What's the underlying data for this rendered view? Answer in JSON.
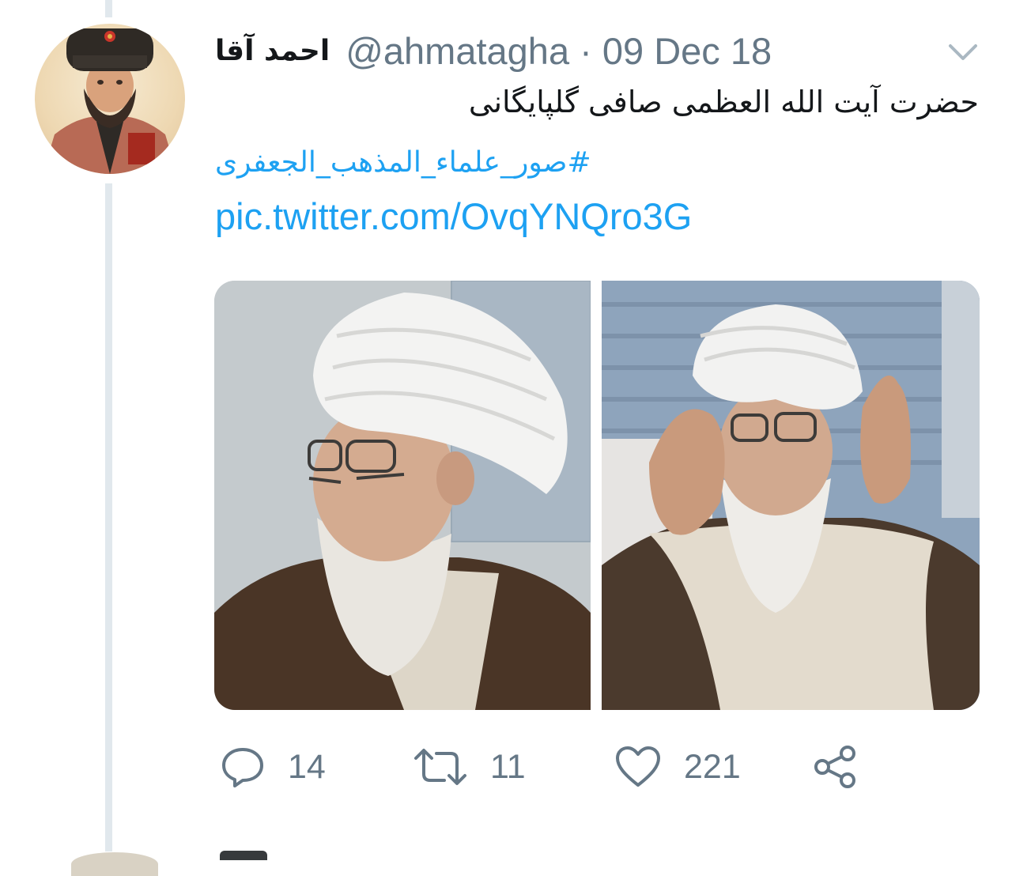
{
  "tweet": {
    "display_name": "احمد آقا",
    "handle": "@ahmatagha",
    "separator": " · ",
    "date": "09 Dec 18",
    "text": "حضرت آیت الله العظمی صافی گلپایگانی",
    "hashtag": "#صور_علماء_المذهب_الجعفری",
    "pic_link": "pic.twitter.com/OvqYNQro3G",
    "media": [
      {
        "icon": "photo-portrait-profile"
      },
      {
        "icon": "photo-portrait-praying"
      }
    ]
  },
  "actions": {
    "reply": {
      "icon": "reply-icon",
      "count": "14"
    },
    "retweet": {
      "icon": "retweet-icon",
      "count": "11"
    },
    "like": {
      "icon": "heart-icon",
      "count": "221"
    },
    "share": {
      "icon": "share-icon"
    }
  },
  "colors": {
    "link": "#1da1f2",
    "muted": "#657786",
    "text": "#14171a",
    "thread_line": "#e1e8ed"
  }
}
